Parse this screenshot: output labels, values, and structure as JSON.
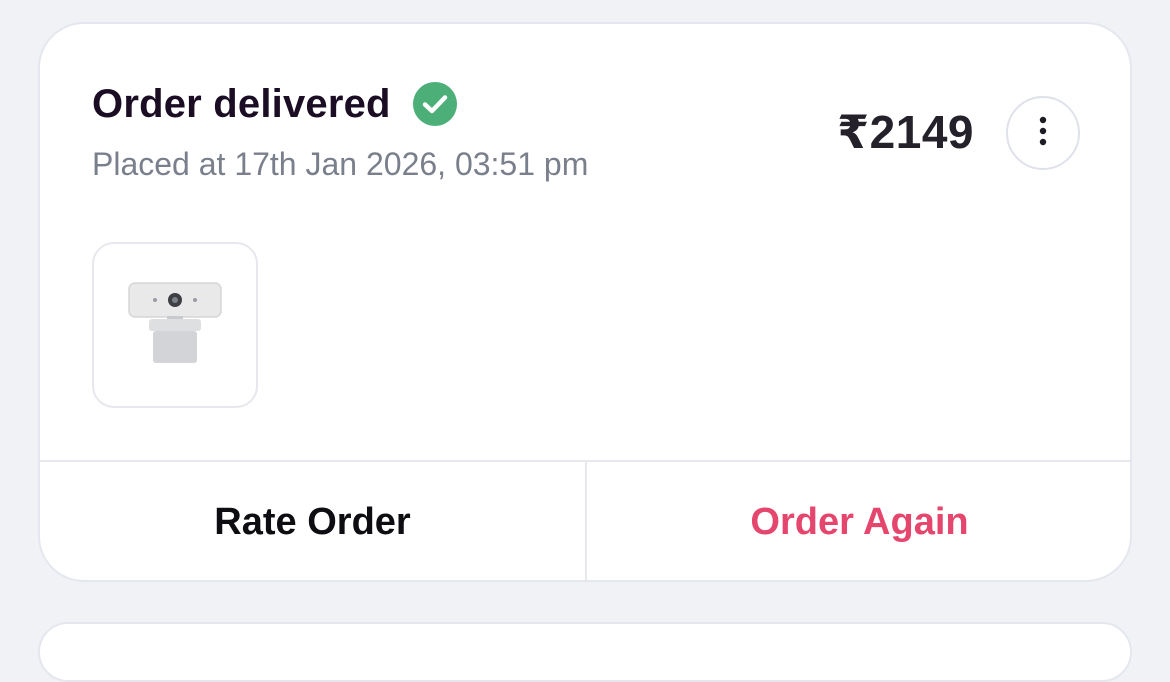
{
  "order": {
    "status_title": "Order delivered",
    "placed_text": "Placed at 17th Jan 2026, 03:51 pm",
    "price": "₹2149",
    "status_icon": "check-circle-icon",
    "menu_icon": "more-vertical-icon",
    "product_image": "webcam-product-image"
  },
  "actions": {
    "rate_label": "Rate Order",
    "order_again_label": "Order Again"
  },
  "colors": {
    "success": "#4caf78",
    "accent": "#e5466d",
    "background": "#f0f2f6"
  }
}
